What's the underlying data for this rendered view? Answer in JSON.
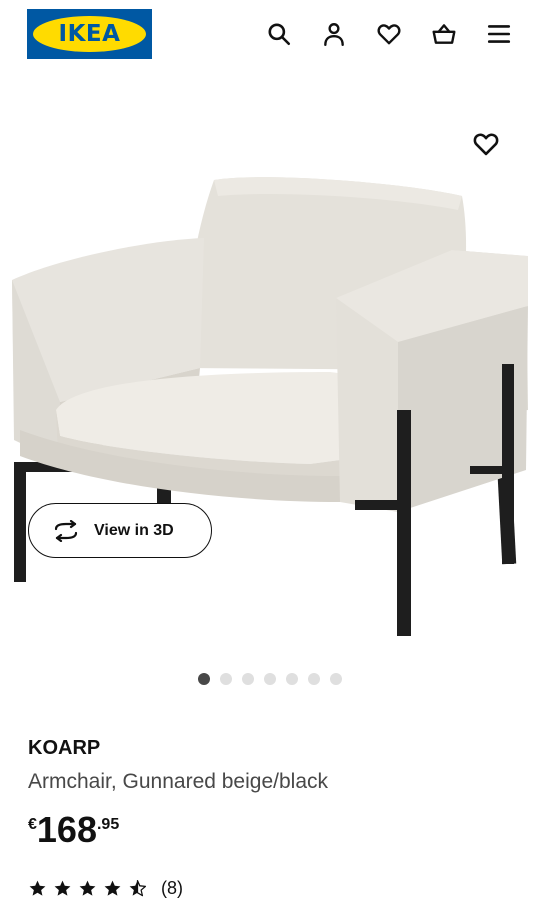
{
  "header": {
    "logo_text": "IKEA",
    "icons": [
      "search-icon",
      "account-icon",
      "favorites-heart-icon",
      "shopping-basket-icon",
      "menu-icon"
    ]
  },
  "product": {
    "name": "KOARP",
    "description": "Armchair, Gunnared beige/black",
    "price": {
      "currency": "€",
      "integer": "168",
      "decimal": ".95"
    },
    "rating": {
      "value": 4.5,
      "max": 5,
      "count_label": "(8)"
    }
  },
  "gallery": {
    "view_3d_label": "View in 3D",
    "total_images": 7,
    "active_index": 0
  },
  "colors": {
    "brand_blue": "#0058a3",
    "brand_yellow": "#ffdb00",
    "text_primary": "#111111",
    "text_secondary": "#484848",
    "dot_active": "#484848",
    "dot_inactive": "#dfdfdf"
  }
}
